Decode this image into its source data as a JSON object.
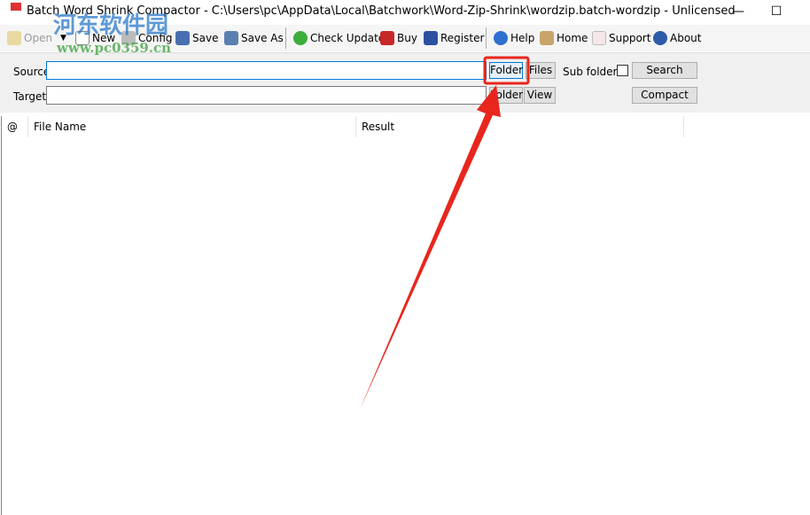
{
  "window": {
    "title": "Batch Word Shrink Compactor - C:\\Users\\pc\\AppData\\Local\\Batchwork\\Word-Zip-Shrink\\wordzip.batch-wordzip - Unlicensed",
    "minimize": "—",
    "maximize": "☐"
  },
  "toolbar": {
    "items": [
      {
        "label": "Open",
        "icon": "folder-open-icon"
      },
      {
        "label": "New",
        "icon": "new-document-icon"
      },
      {
        "label": "Config",
        "icon": "tools-icon"
      },
      {
        "label": "Save",
        "icon": "floppy-icon"
      },
      {
        "label": "Save As",
        "icon": "save-as-icon"
      },
      {
        "label": "Check Update",
        "icon": "refresh-icon"
      },
      {
        "label": "Buy",
        "icon": "cart-icon"
      },
      {
        "label": "Register",
        "icon": "user-icon"
      },
      {
        "label": "Help",
        "icon": "help-icon"
      },
      {
        "label": "Home",
        "icon": "home-icon"
      },
      {
        "label": "Support",
        "icon": "mail-icon"
      },
      {
        "label": "About",
        "icon": "info-icon"
      }
    ],
    "open_dropdown": "▼"
  },
  "form": {
    "source_label": "Source",
    "target_label": "Target",
    "source_value": "",
    "target_value": "",
    "folder": "Folder",
    "files": "Files",
    "view": "View",
    "subfolders": "Sub folders",
    "subfolders_checked": false,
    "search": "Search",
    "compact": "Compact"
  },
  "table": {
    "columns": [
      "@",
      "File Name",
      "Result"
    ],
    "rows": []
  },
  "watermark": {
    "text": "河东软件园",
    "url": "www.pc0359.cn"
  },
  "annotation": {
    "color": "#e8261e"
  }
}
